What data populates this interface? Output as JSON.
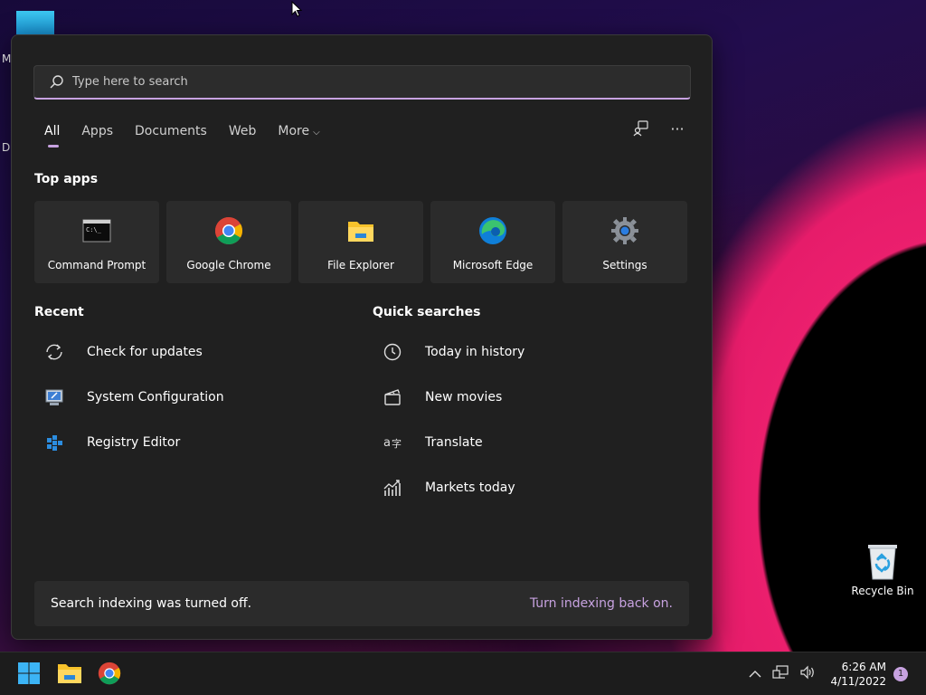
{
  "desktop": {
    "partial_label_1": "M",
    "partial_label_2": "D",
    "recycle_bin_label": "Recycle Bin"
  },
  "search": {
    "placeholder": "Type here to search",
    "value": ""
  },
  "tabs": [
    {
      "label": "All",
      "active": true
    },
    {
      "label": "Apps"
    },
    {
      "label": "Documents"
    },
    {
      "label": "Web"
    },
    {
      "label": "More"
    }
  ],
  "top_apps": {
    "title": "Top apps",
    "items": [
      {
        "label": "Command Prompt",
        "icon": "command-prompt-icon"
      },
      {
        "label": "Google Chrome",
        "icon": "chrome-icon"
      },
      {
        "label": "File Explorer",
        "icon": "file-explorer-icon"
      },
      {
        "label": "Microsoft Edge",
        "icon": "edge-icon"
      },
      {
        "label": "Settings",
        "icon": "settings-gear-icon"
      }
    ]
  },
  "recent": {
    "title": "Recent",
    "items": [
      {
        "label": "Check for updates",
        "icon": "refresh-icon"
      },
      {
        "label": "System Configuration",
        "icon": "system-config-icon"
      },
      {
        "label": "Registry Editor",
        "icon": "registry-editor-icon"
      }
    ]
  },
  "quick_searches": {
    "title": "Quick searches",
    "items": [
      {
        "label": "Today in history",
        "icon": "clock-icon"
      },
      {
        "label": "New movies",
        "icon": "clapper-icon"
      },
      {
        "label": "Translate",
        "icon": "translate-icon"
      },
      {
        "label": "Markets today",
        "icon": "chart-icon"
      }
    ]
  },
  "notice": {
    "text": "Search indexing was turned off.",
    "link": "Turn indexing back on."
  },
  "taskbar": {
    "time": "6:26 AM",
    "date": "4/11/2022",
    "notification_count": "1"
  },
  "colors": {
    "accent": "#c7a2e0",
    "panel_bg": "#202020",
    "tile_bg": "#2b2b2b"
  }
}
